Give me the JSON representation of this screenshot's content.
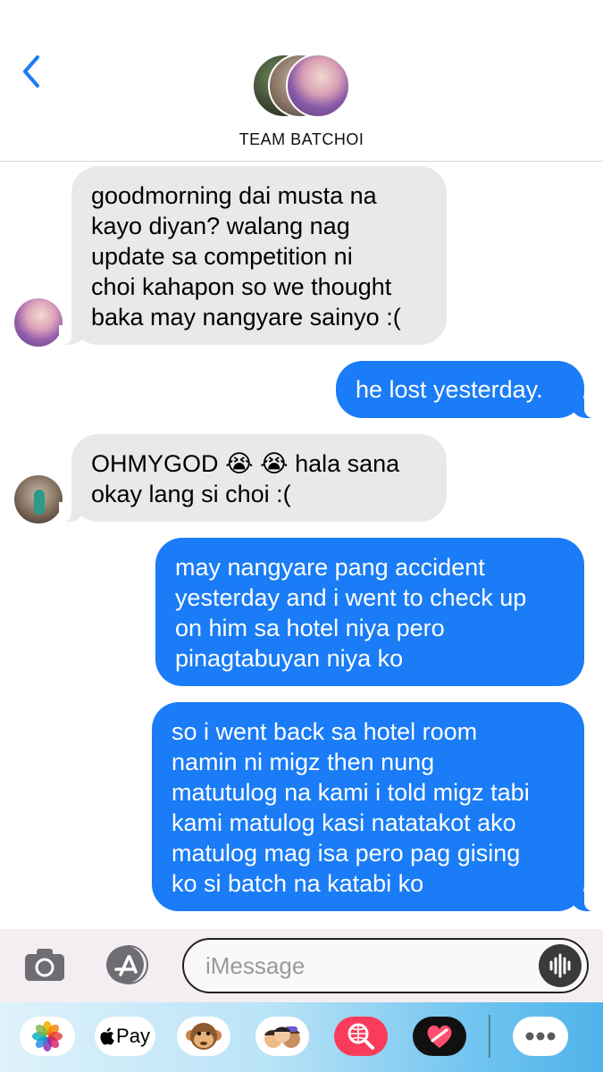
{
  "header": {
    "title": "TEAM BATCHOI",
    "back_icon": "chevron-left-icon",
    "accent_color": "#1a7cf6"
  },
  "messages": [
    {
      "direction": "incoming",
      "sender_avatar": "avatar-1",
      "text": "goodmorning dai musta na\nkayo diyan? walang nag\nupdate sa competition ni\nchoi kahapon so we thought\nbaka may nangyare sainyo :("
    },
    {
      "direction": "outgoing",
      "text": "he lost yesterday."
    },
    {
      "direction": "incoming",
      "sender_avatar": "avatar-2",
      "text": "OHMYGOD 😭 😭 hala sana\nokay lang si choi :("
    },
    {
      "direction": "outgoing",
      "text": "may nangyare pang accident\nyesterday and i went to check up\non him sa hotel niya pero\npinagtabuyan niya ko"
    },
    {
      "direction": "outgoing",
      "text": "so i went back sa hotel room\nnamin ni migz then nung\nmatutulog na kami i told migz tabi\nkami matulog kasi natatakot ako\nmatulog mag isa pero pag gising\nko si batch na katabi ko"
    }
  ],
  "composer": {
    "placeholder": "iMessage",
    "camera_icon": "camera-icon",
    "appstore_icon": "app-store-icon",
    "audio_icon": "audio-waveform-icon"
  },
  "app_drawer": {
    "pay_label": "Pay",
    "apps": [
      "photos-icon",
      "apple-pay-icon",
      "monkey-emoji-icon",
      "memoji-icon",
      "web-search-icon",
      "digital-touch-heart-icon",
      "more-icon"
    ]
  },
  "colors": {
    "incoming_bubble": "#e9e9eb",
    "outgoing_bubble": "#1a7cf6",
    "battery": "#4cd964"
  }
}
